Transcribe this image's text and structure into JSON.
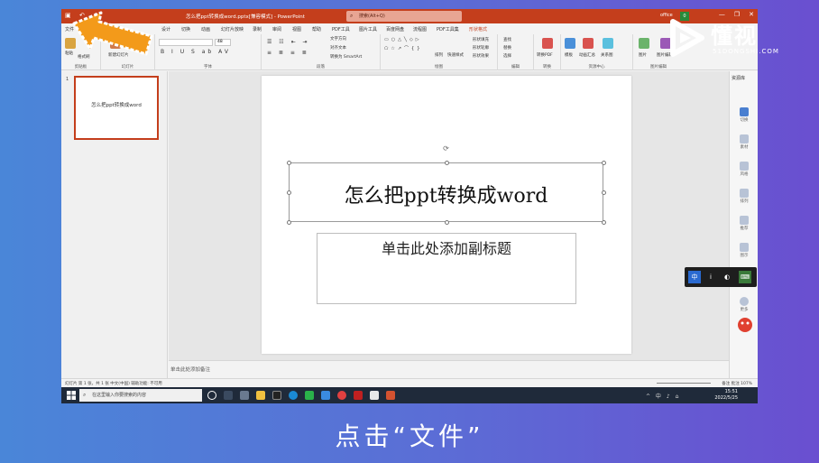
{
  "window": {
    "title": "怎么把ppt转换成word.pptx[兼容模式] - PowerPoint",
    "search_placeholder": "搜索(Alt+Q)",
    "account": "office",
    "account_badge": "0",
    "controls": [
      "—",
      "❐",
      "✕"
    ]
  },
  "tabs": [
    {
      "label": "文件"
    },
    {
      "label": "开始"
    },
    {
      "label": "插入"
    },
    {
      "label": "绘图"
    },
    {
      "label": "设计"
    },
    {
      "label": "切换"
    },
    {
      "label": "动画"
    },
    {
      "label": "幻灯片放映"
    },
    {
      "label": "录制"
    },
    {
      "label": "审阅"
    },
    {
      "label": "视图"
    },
    {
      "label": "帮助"
    },
    {
      "label": "PDF工具"
    },
    {
      "label": "图片工具"
    },
    {
      "label": "百度网盘"
    },
    {
      "label": "流程图"
    },
    {
      "label": "PDF工具集"
    },
    {
      "label": "形状格式"
    }
  ],
  "ribbon": {
    "groups": [
      "剪贴板",
      "幻灯片",
      "字体",
      "段落",
      "绘图",
      "编辑",
      "转换",
      "资源中心",
      "图片编辑"
    ],
    "clipboard": {
      "paste": "粘贴",
      "format_painter": "格式刷"
    },
    "slides": {
      "new_slide": "新建幻灯片"
    },
    "font": {
      "font_name": "",
      "font_size": "48",
      "styles": "B I U S ab AV"
    },
    "paragraph": {
      "text_direction": "文字方向",
      "align_text": "对齐文本",
      "smartart": "转换为 SmartArt"
    },
    "drawing": {
      "arrange": "排列",
      "quick_styles": "快速样式",
      "shape_fill": "形状填充",
      "shape_outline": "形状轮廓",
      "shape_effects": "形状效果"
    },
    "editing": {
      "find": "查找",
      "replace": "替换",
      "select": "选择"
    },
    "convert": {
      "to_pdf": "转换PDF"
    },
    "resources": {
      "template": "模板",
      "animation": "动画汇总",
      "icons": "关系图"
    },
    "image": {
      "chart": "图片",
      "image_editor": "图片编辑"
    }
  },
  "slide_panel": {
    "thumbnails": [
      {
        "number": "1",
        "title": "怎么把ppt转换成word"
      }
    ]
  },
  "slide": {
    "title": "怎么把ppt转换成word",
    "subtitle": "单击此处添加副标题"
  },
  "notes_placeholder": "单击此处添加备注",
  "right_pane": {
    "title": "资源库",
    "items": [
      "切换",
      "素材",
      "风格",
      "排列",
      "推荐",
      "图示",
      "商城",
      "更多"
    ]
  },
  "statusbar": {
    "left": "幻灯片 第 1 张，共 1 张    中文(中国)    辅助功能: 不可用",
    "right": "备注    批注    107%"
  },
  "taskbar": {
    "search_placeholder": "在这里输入你要搜索的内容",
    "time": "15:51",
    "date": "2022/5/25",
    "tray": "^ 中 ♪ ⌂"
  },
  "ime_toolbar": [
    "中",
    "ⅰ",
    "◐",
    "⌨"
  ],
  "logo": {
    "name": "懂视",
    "domain": "51DONGSHI.COM"
  },
  "caption": "点击“文件”",
  "colors": {
    "accent": "#c43e1c",
    "taskbar": "#1f2a3a",
    "background_start": "#4a86d8",
    "background_end": "#6a4fd0"
  }
}
